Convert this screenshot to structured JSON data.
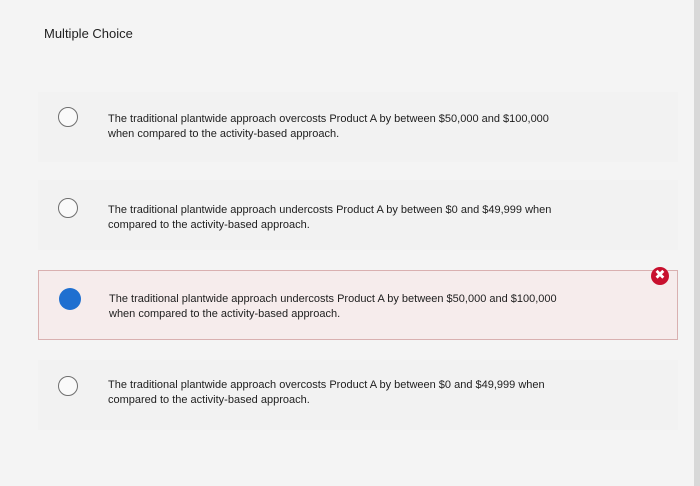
{
  "question": {
    "label": "Multiple Choice"
  },
  "options": [
    {
      "text": "The traditional plantwide approach overcosts Product A by between $50,000 and $100,000 when compared to the activity-based approach.",
      "selected": false,
      "status": ""
    },
    {
      "text": "The traditional plantwide approach undercosts Product A by between $0 and $49,999 when compared to the activity-based approach.",
      "selected": false,
      "status": ""
    },
    {
      "text": "The traditional plantwide approach undercosts Product A by between $50,000 and $100,000 when compared to the activity-based approach.",
      "selected": true,
      "status": "incorrect"
    },
    {
      "text": "The traditional plantwide approach overcosts Product A by between $0 and $49,999 when compared to the activity-based approach.",
      "selected": false,
      "status": ""
    }
  ],
  "icons": {
    "incorrect_badge": "close-icon",
    "incorrect_glyph": "✖"
  },
  "colors": {
    "selected_radio": "#1f6fd0",
    "incorrect": "#c8102e",
    "incorrect_bg": "#f6ecec"
  }
}
